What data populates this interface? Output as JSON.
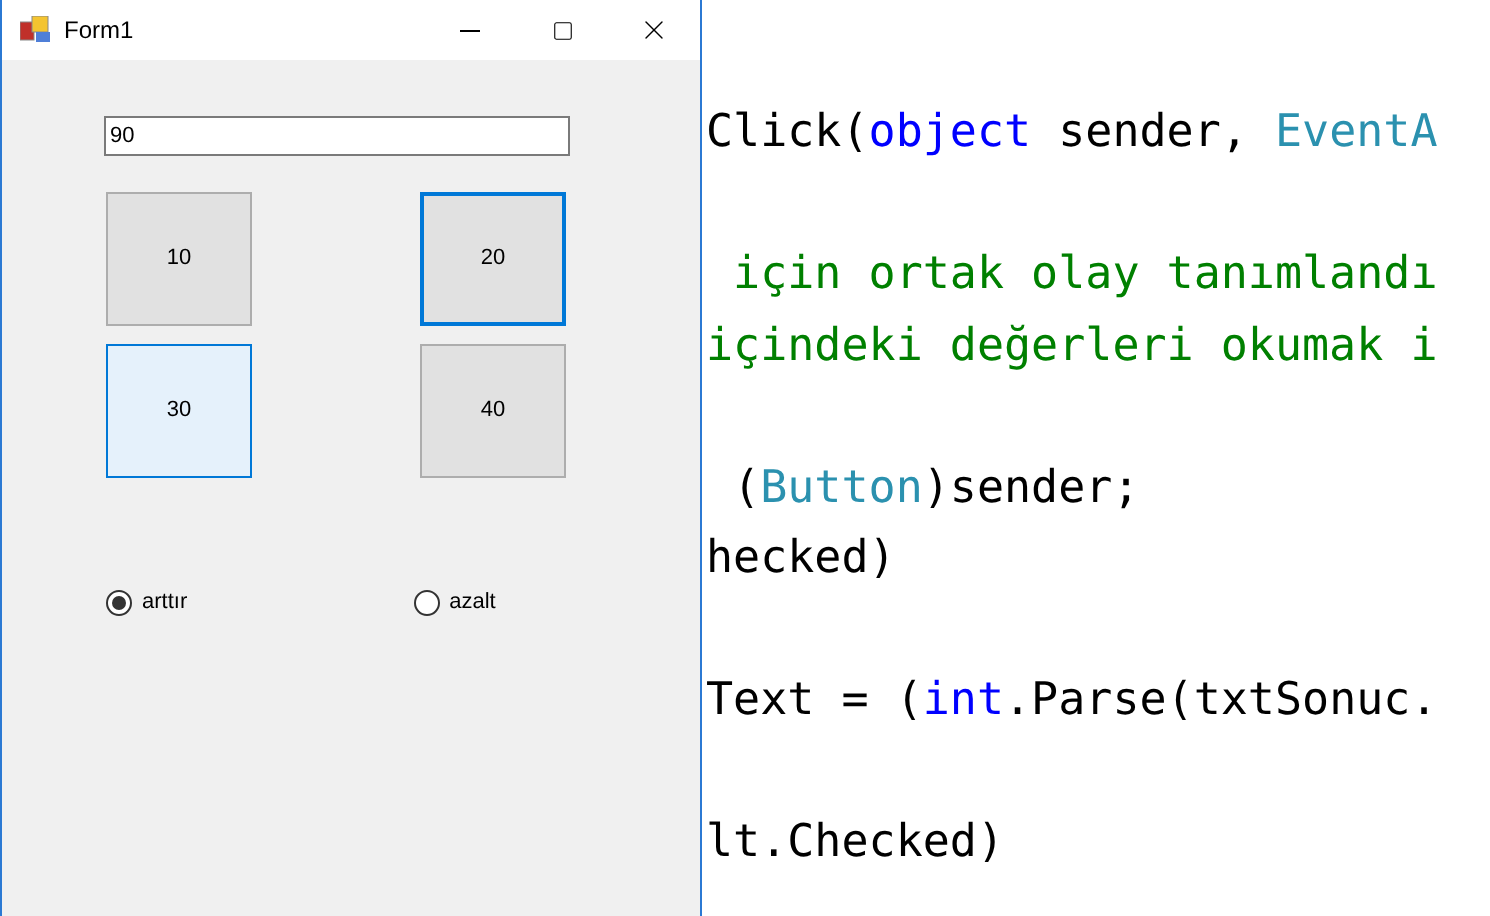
{
  "window": {
    "title": "Form1"
  },
  "textbox": {
    "value": "90"
  },
  "buttons": [
    {
      "label": "10",
      "focused": false,
      "hovered": false
    },
    {
      "label": "20",
      "focused": true,
      "hovered": false
    },
    {
      "label": "30",
      "focused": false,
      "hovered": true
    },
    {
      "label": "40",
      "focused": false,
      "hovered": false
    }
  ],
  "radios": [
    {
      "label": "arttır",
      "selected": true
    },
    {
      "label": "azalt",
      "selected": false
    }
  ],
  "code_lines": [
    {
      "kind": "code",
      "segments": [
        {
          "text": "Click(",
          "kind": "plain"
        },
        {
          "text": "object",
          "kind": "keyword"
        },
        {
          "text": " sender, ",
          "kind": "plain"
        },
        {
          "text": "EventA",
          "kind": "type"
        }
      ]
    },
    {
      "kind": "blank"
    },
    {
      "kind": "code",
      "segments": [
        {
          "text": " için ortak olay tanımlandı",
          "kind": "comment"
        }
      ]
    },
    {
      "kind": "code",
      "segments": [
        {
          "text": "içindeki değerleri okumak i",
          "kind": "comment"
        }
      ]
    },
    {
      "kind": "blank"
    },
    {
      "kind": "code",
      "segments": [
        {
          "text": " (",
          "kind": "plain"
        },
        {
          "text": "Button",
          "kind": "type"
        },
        {
          "text": ")sender;",
          "kind": "plain"
        }
      ]
    },
    {
      "kind": "code",
      "segments": [
        {
          "text": "hecked)",
          "kind": "plain"
        }
      ]
    },
    {
      "kind": "blank"
    },
    {
      "kind": "code",
      "segments": [
        {
          "text": "Text = (",
          "kind": "plain"
        },
        {
          "text": "int",
          "kind": "keyword"
        },
        {
          "text": ".Parse(txtSonuc.",
          "kind": "plain"
        }
      ]
    },
    {
      "kind": "blank"
    },
    {
      "kind": "code",
      "segments": [
        {
          "text": "lt.Checked)",
          "kind": "plain"
        }
      ]
    }
  ]
}
